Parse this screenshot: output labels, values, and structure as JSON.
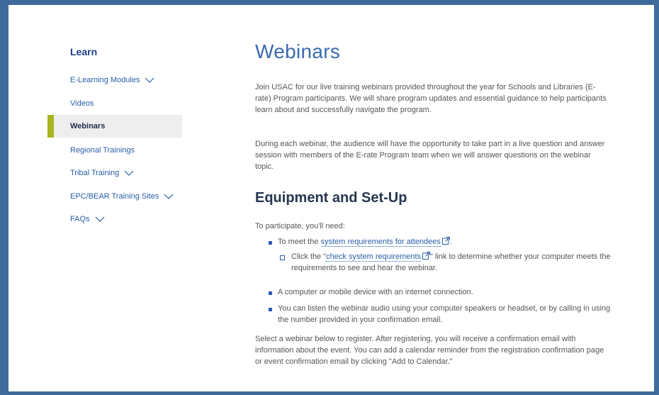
{
  "sidebar": {
    "heading": "Learn",
    "items": [
      {
        "label": "E-Learning Modules",
        "chevron": true,
        "active": false
      },
      {
        "label": "Videos",
        "chevron": false,
        "active": false
      },
      {
        "label": "Webinars",
        "chevron": false,
        "active": true
      },
      {
        "label": "Regional Trainings",
        "chevron": false,
        "active": false
      },
      {
        "label": "Tribal Training",
        "chevron": true,
        "active": false
      },
      {
        "label": "EPC/BEAR Training Sites",
        "chevron": true,
        "active": false
      },
      {
        "label": "FAQs",
        "chevron": true,
        "active": false
      }
    ]
  },
  "main": {
    "title": "Webinars",
    "intro": "Join USAC for our live training webinars provided throughout the year for Schools and Libraries (E-rate) Program participants. We will share program updates and essential guidance to help participants learn about and successfully navigate the program.",
    "intro2": "During each webinar, the audience will have the opportunity to take part in a live question and answer session with members of the E-rate Program team when we will answer questions on the webinar topic.",
    "equipment_heading": "Equipment and Set-Up",
    "participate": "To participate, you'll need:",
    "list": {
      "item1_prefix": "To meet the ",
      "item1_link": "system requirements for attendees",
      "item1_suffix": ".",
      "sub1_prefix": "Click the \"",
      "sub1_link": "check system requirements",
      "sub1_suffix": "\" link to determine whether your computer meets the requirements to see and hear the webinar.",
      "item2": "A computer or mobile device with an internet connection.",
      "item3": "You can listen the webinar audio using your computer speakers or headset, or by calling in using the number provided in your confirmation email."
    },
    "outro": "Select a webinar below to register. After registering, you will receive a confirmation email with information about the event. You can add a calendar reminder from the registration confirmation page or event confirmation email by clicking \"Add to Calendar.\""
  },
  "colors": {
    "border": "#3f6b9c",
    "accent_bar": "#a7b51e",
    "link": "#2a5ea8",
    "title": "#3a6ab0"
  }
}
